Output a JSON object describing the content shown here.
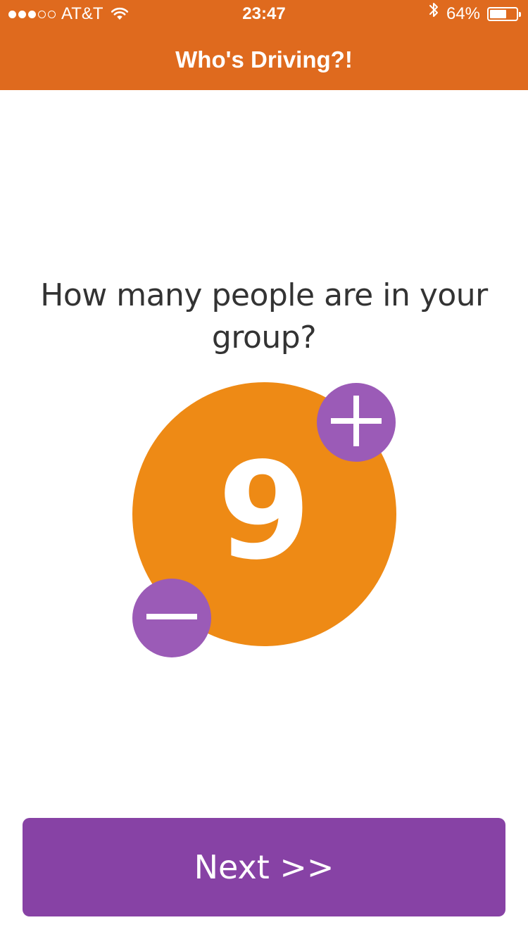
{
  "status_bar": {
    "carrier": "AT&T",
    "signal_bars_filled": 3,
    "signal_bars_total": 5,
    "time": "23:47",
    "battery_percent_label": "64%",
    "battery_level": 0.64
  },
  "header": {
    "title": "Who's Driving?!"
  },
  "question": {
    "text": "How many people are in your group?"
  },
  "counter": {
    "value": "9",
    "increment_icon": "plus-icon",
    "decrement_icon": "minus-icon"
  },
  "next_button": {
    "label": "Next >>"
  },
  "colors": {
    "header": "#df6a1e",
    "counter_circle": "#ee8a15",
    "step_buttons": "#9b5bb7",
    "next_button": "#8742a5"
  }
}
